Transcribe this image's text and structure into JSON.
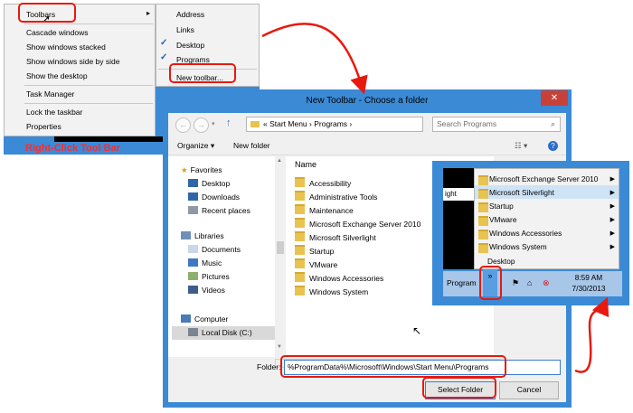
{
  "context_menu": {
    "items": [
      {
        "label": "Toolbars",
        "has_submenu": true
      },
      {
        "label": "Cascade windows"
      },
      {
        "label": "Show windows stacked"
      },
      {
        "label": "Show windows side by side"
      },
      {
        "label": "Show the desktop"
      },
      {
        "label": "Task Manager"
      },
      {
        "label": "Lock the taskbar"
      },
      {
        "label": "Properties"
      }
    ],
    "submenu": [
      {
        "label": "Address",
        "checked": false
      },
      {
        "label": "Links",
        "checked": false
      },
      {
        "label": "Desktop",
        "checked": true
      },
      {
        "label": "Programs",
        "checked": true
      },
      {
        "label": "New toolbar...",
        "checked": false
      }
    ],
    "caption": "Right-Click Tool Bar",
    "check_glyph": "✓",
    "submenu_glyph": "▸"
  },
  "dialog": {
    "title": "New Toolbar - Choose a folder",
    "close_glyph": "✕",
    "breadcrumb": "«  Start Menu  ›  Programs  ›",
    "search_placeholder": "Search Programs",
    "toolbar": {
      "organize": "Organize ▾",
      "new_folder": "New folder"
    },
    "nav": {
      "favorites": "Favorites",
      "favorite_items": [
        "Desktop",
        "Downloads",
        "Recent places"
      ],
      "libraries": "Libraries",
      "library_items": [
        "Documents",
        "Music",
        "Pictures",
        "Videos"
      ],
      "computer": "Computer",
      "computer_items": [
        "Local Disk (C:)"
      ]
    },
    "column_header": "Name",
    "folders": [
      "Accessibility",
      "Administrative Tools",
      "Maintenance",
      "Microsoft Exchange Server 2010",
      "Microsoft Silverlight",
      "Startup",
      "VMware",
      "Windows Accessories",
      "Windows System"
    ],
    "folder_label": "Folder:",
    "folder_value": "%ProgramData%\\Microsoft\\Windows\\Start Menu\\Programs",
    "select_button": "Select Folder",
    "cancel_button": "Cancel"
  },
  "taskbar_menu": {
    "items": [
      {
        "label": "Microsoft Exchange Server 2010",
        "has_submenu": true
      },
      {
        "label": "Microsoft Silverlight",
        "has_submenu": true,
        "highlighted": true
      },
      {
        "label": "Startup",
        "has_submenu": true
      },
      {
        "label": "VMware",
        "has_submenu": true
      },
      {
        "label": "Windows Accessories",
        "has_submenu": true
      },
      {
        "label": "Windows System",
        "has_submenu": true
      },
      {
        "label": "Desktop",
        "has_submenu": false
      }
    ],
    "left_fragment": "ight",
    "taskbar_label": "Program",
    "chevron": "»",
    "clock_time": "8:59 AM",
    "clock_date": "7/30/2013"
  },
  "colors": {
    "accent_blue": "#3b8ad6",
    "callout_red": "#e8190e",
    "caption_red": "#ff2a2a"
  }
}
